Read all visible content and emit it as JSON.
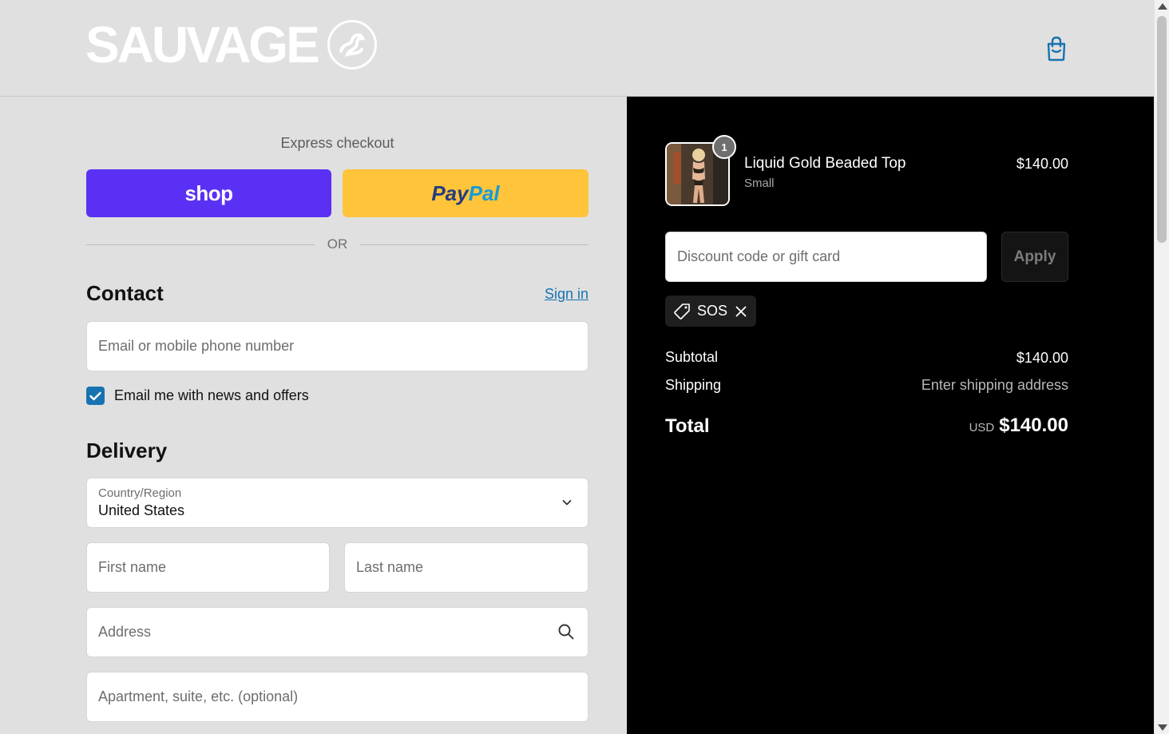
{
  "brand": {
    "name": "SAUVAGE"
  },
  "header": {
    "cart_icon": "shopping-bag-icon"
  },
  "express": {
    "title": "Express checkout",
    "shop_label": "shop",
    "paypal_part1": "Pay",
    "paypal_part2": "Pal",
    "or_label": "OR"
  },
  "contact": {
    "title": "Contact",
    "signin_label": "Sign in",
    "email_placeholder": "Email or mobile phone number",
    "newsletter_label": "Email me with news and offers",
    "newsletter_checked": true
  },
  "delivery": {
    "title": "Delivery",
    "country_label": "Country/Region",
    "country_value": "United States",
    "first_name_placeholder": "First name",
    "last_name_placeholder": "Last name",
    "address_placeholder": "Address",
    "apartment_placeholder": "Apartment, suite, etc. (optional)"
  },
  "summary": {
    "item": {
      "quantity": "1",
      "name": "Liquid Gold Beaded Top",
      "variant": "Small",
      "price": "$140.00"
    },
    "discount_placeholder": "Discount code or gift card",
    "apply_label": "Apply",
    "applied_code": "SOS",
    "subtotal_label": "Subtotal",
    "subtotal_value": "$140.00",
    "shipping_label": "Shipping",
    "shipping_value": "Enter shipping address",
    "total_label": "Total",
    "total_currency": "USD",
    "total_value": "$140.00"
  },
  "colors": {
    "shop_purple": "#5a31f4",
    "paypal_yellow": "#ffc439",
    "link_blue": "#1773b0",
    "summary_bg": "#000000",
    "page_bg": "#e0e0e0"
  }
}
